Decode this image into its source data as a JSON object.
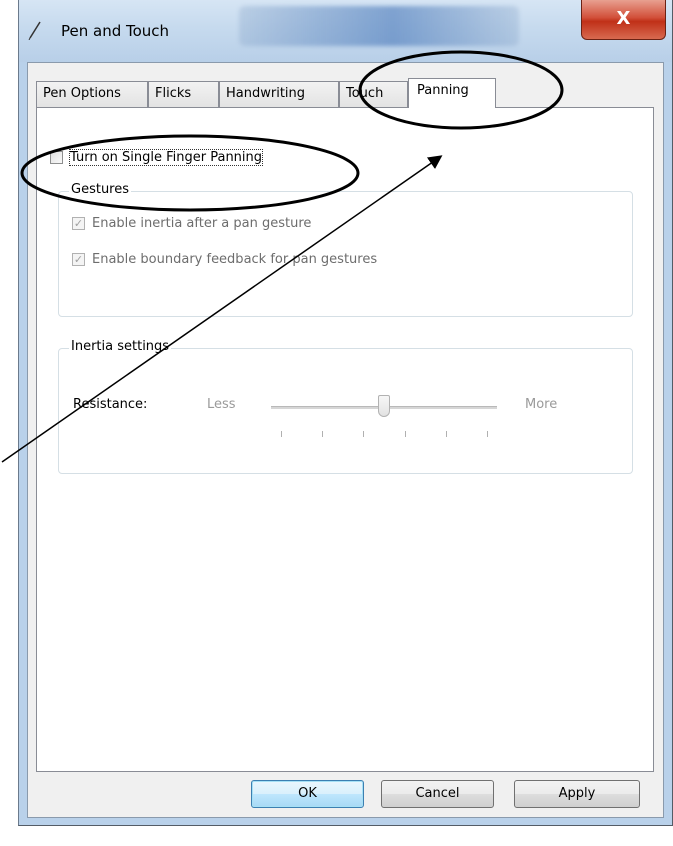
{
  "window": {
    "title": "Pen and Touch",
    "close_glyph": "X"
  },
  "tabs": [
    {
      "label": "Pen Options",
      "active": false
    },
    {
      "label": "Flicks",
      "active": false
    },
    {
      "label": "Handwriting",
      "active": false
    },
    {
      "label": "Touch",
      "active": false
    },
    {
      "label": "Panning",
      "active": true
    }
  ],
  "panning": {
    "single_finger": {
      "label": "Turn on Single Finger Panning",
      "checked": false
    },
    "gestures": {
      "label": "Gestures",
      "items": [
        {
          "label": "Enable inertia after a pan gesture",
          "checked": true,
          "enabled": false
        },
        {
          "label": "Enable boundary feedback for pan gestures",
          "checked": true,
          "enabled": false
        }
      ]
    },
    "inertia": {
      "label": "Inertia settings",
      "resistance_label": "Resistance:",
      "min_label": "Less",
      "max_label": "More",
      "slider_level": 0.5,
      "tick_count": 6
    }
  },
  "buttons": {
    "ok": "OK",
    "cancel": "Cancel",
    "apply": "Apply"
  },
  "annotation": {
    "color": "#000000",
    "icons": [
      "ellipse-highlight",
      "pointer-arrow"
    ]
  }
}
